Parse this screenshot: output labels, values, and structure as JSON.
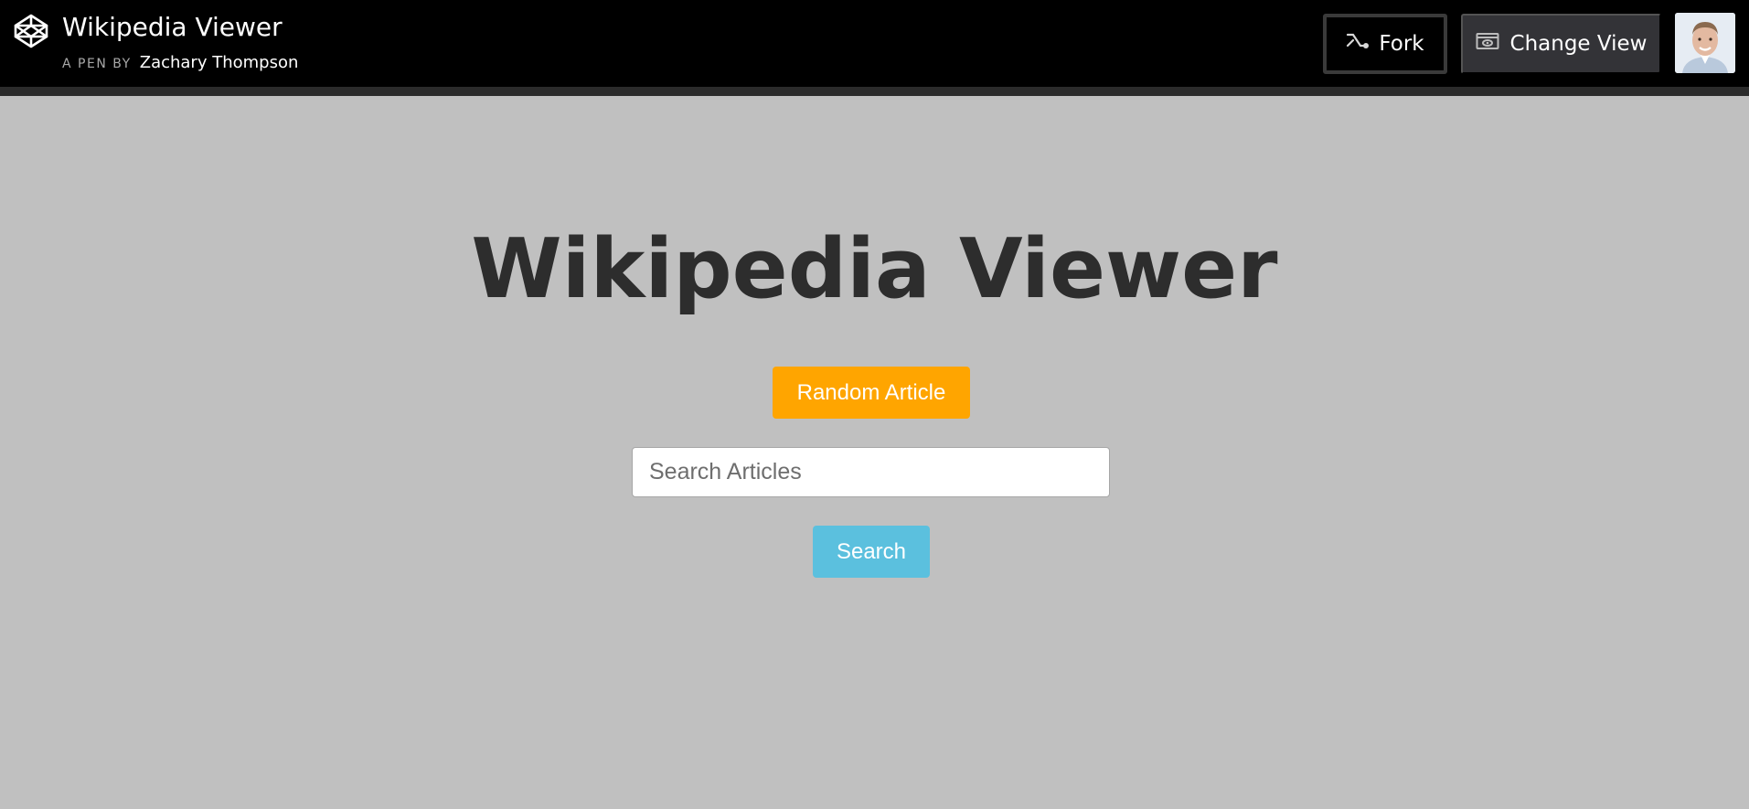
{
  "header": {
    "pen_title": "Wikipedia Viewer",
    "byline_prefix": "A PEN BY",
    "author": "Zachary Thompson",
    "logo_icon": "codepen-logo-icon",
    "fork_label": "Fork",
    "fork_icon": "fork-icon",
    "change_view_label": "Change View",
    "change_view_icon": "change-view-icon",
    "avatar": "user-avatar"
  },
  "main": {
    "title": "Wikipedia Viewer",
    "random_button_label": "Random Article",
    "search": {
      "value": "",
      "placeholder": "Search Articles"
    },
    "search_button_label": "Search"
  },
  "colors": {
    "topbar_bg": "#000000",
    "page_bg": "#c0c0c0",
    "random_button": "#ffa500",
    "search_button": "#5bc0de",
    "title_text": "#2d2d2d"
  }
}
